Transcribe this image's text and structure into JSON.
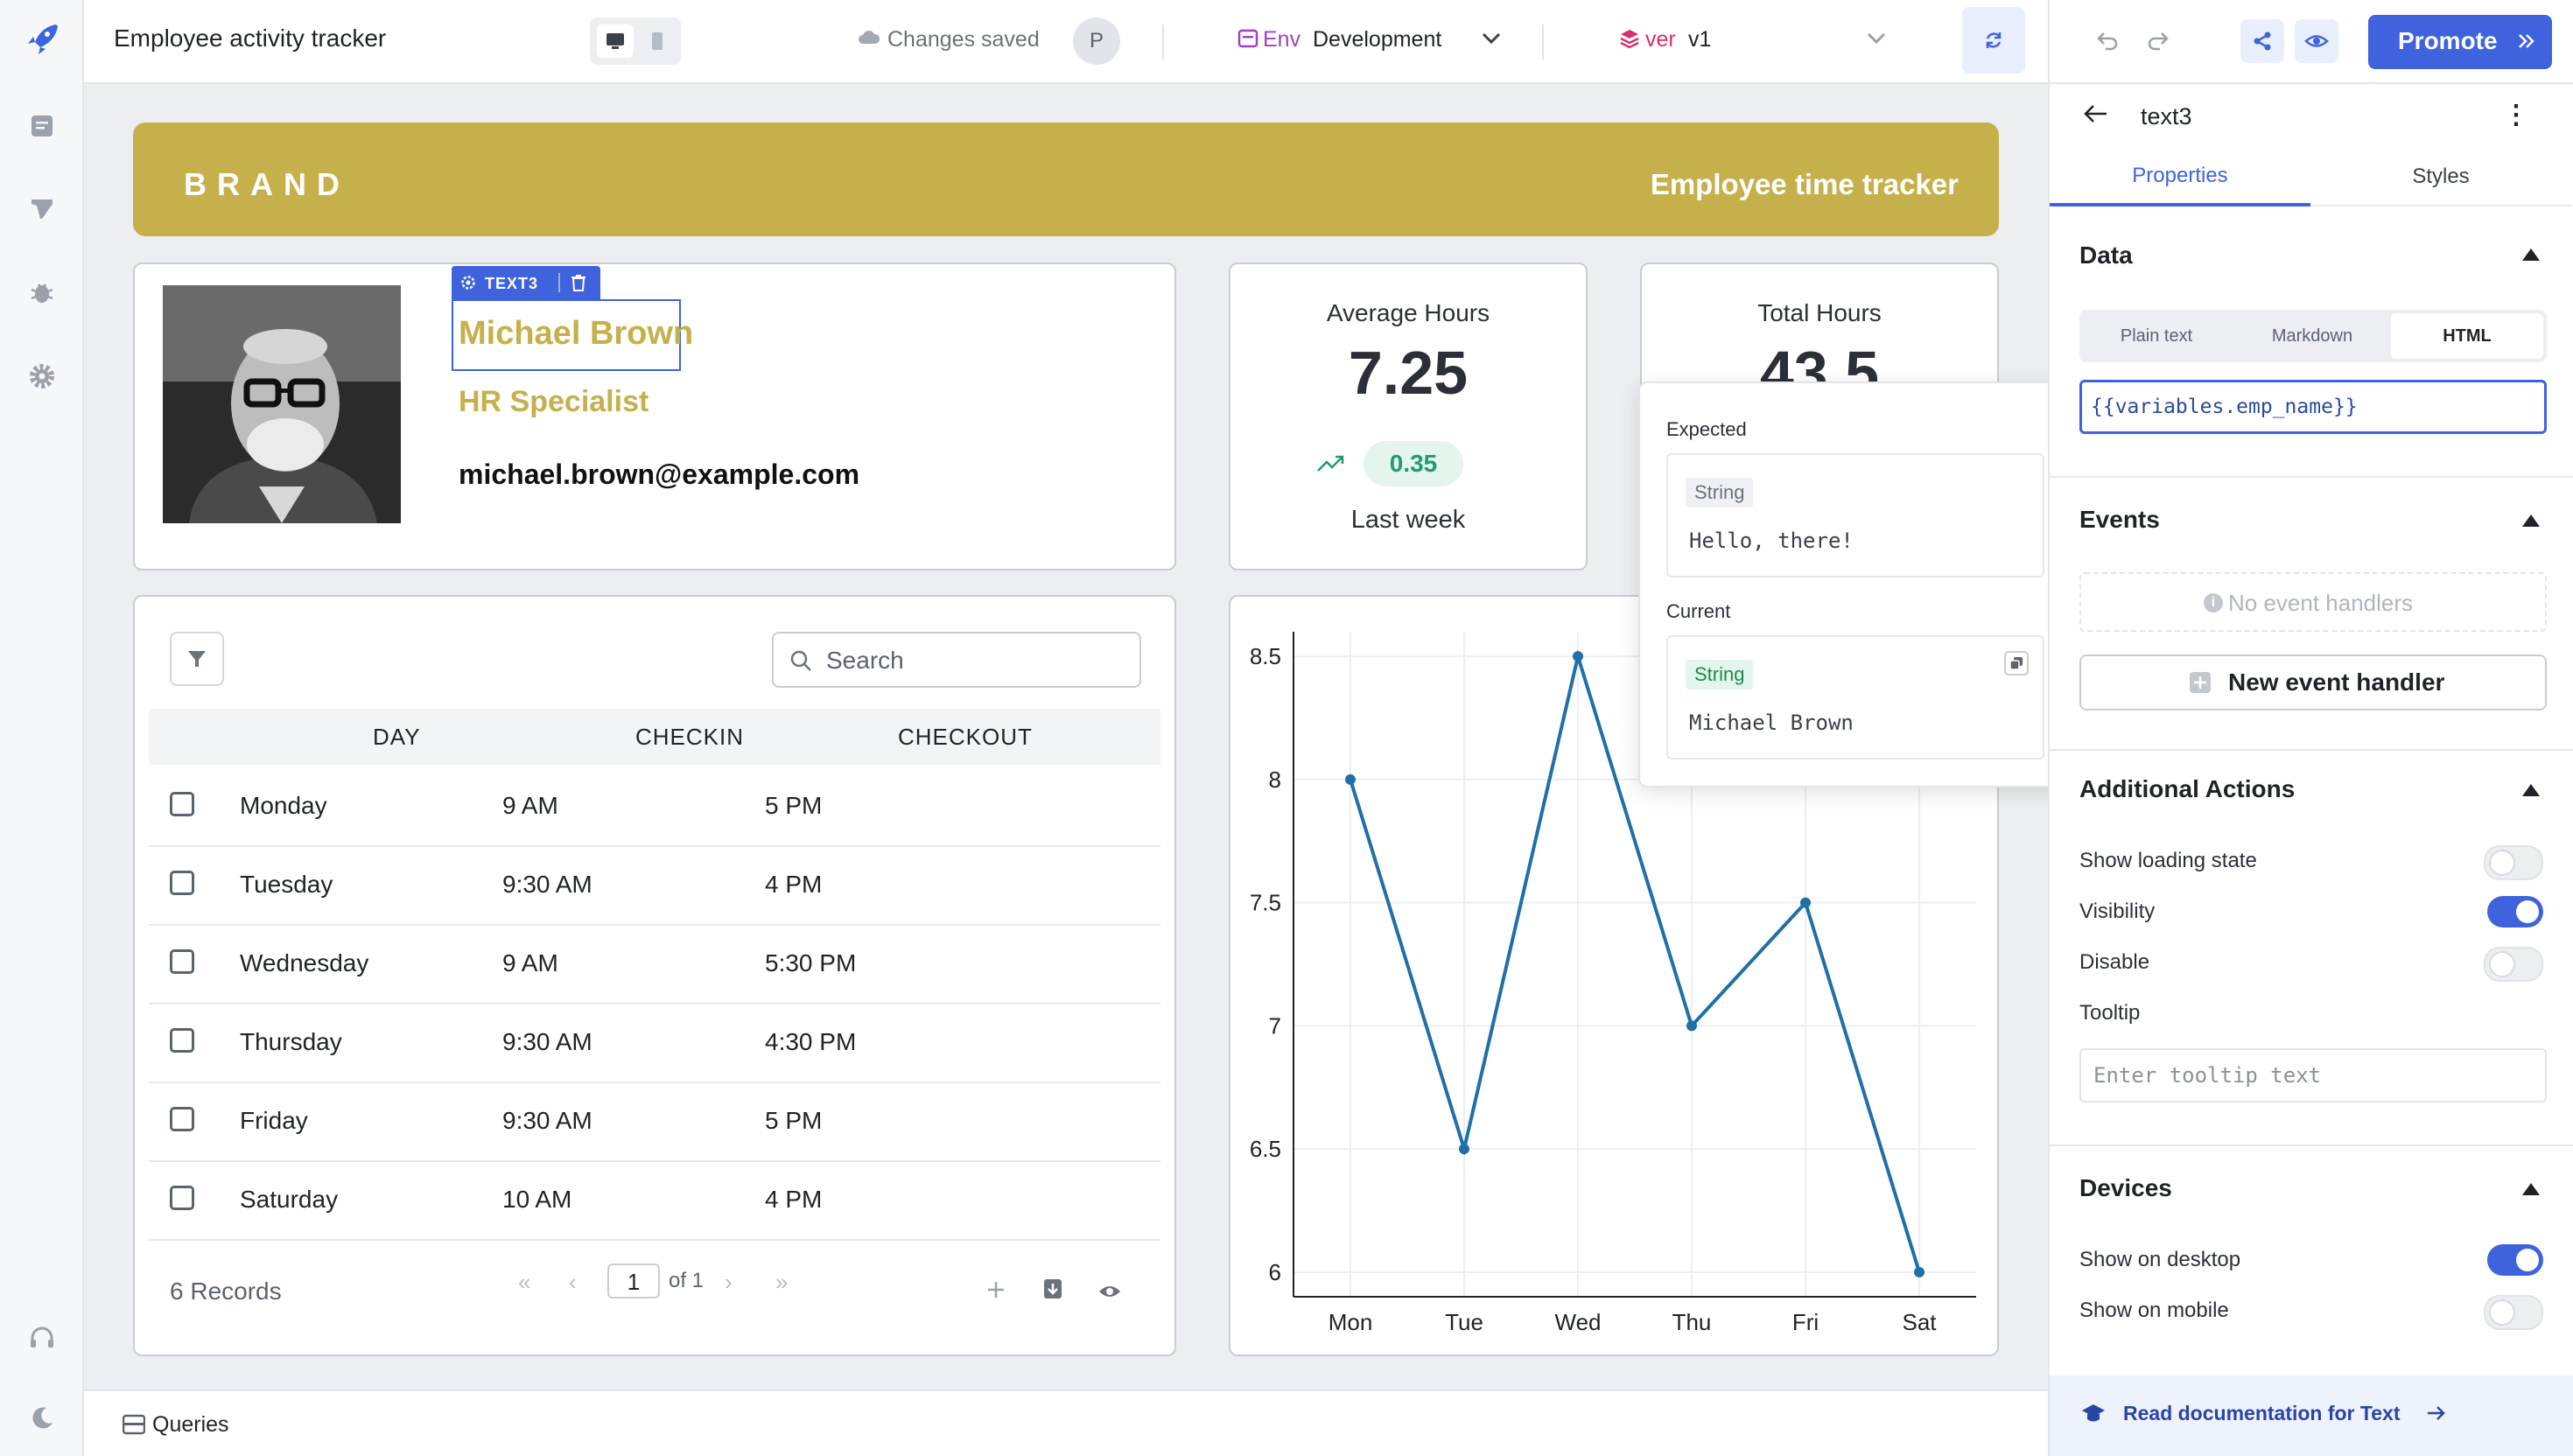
{
  "app": {
    "title": "Employee activity tracker",
    "save_status": "Changes saved",
    "avatar_initial": "P",
    "env_label": "Env",
    "env_value": "Development",
    "ver_label": "ver",
    "ver_value": "v1",
    "promote_label": "Promote"
  },
  "header": {
    "brand": "BRAND",
    "tracker_title": "Employee time tracker"
  },
  "profile": {
    "name": "Michael Brown",
    "role": "HR Specialist",
    "email": "michael.brown@example.com",
    "selected_tag": "TEXT3"
  },
  "stats": {
    "avg_title": "Average Hours",
    "avg_value": "7.25",
    "delta": "0.35",
    "period": "Last week",
    "total_title": "Total Hours",
    "total_value": "43.5"
  },
  "table": {
    "search_placeholder": "Search",
    "columns": [
      "DAY",
      "CHECKIN",
      "CHECKOUT"
    ],
    "rows": [
      [
        "Monday",
        "9 AM",
        "5 PM"
      ],
      [
        "Tuesday",
        "9:30 AM",
        "4 PM"
      ],
      [
        "Wednesday",
        "9 AM",
        "5:30 PM"
      ],
      [
        "Thursday",
        "9:30 AM",
        "4:30 PM"
      ],
      [
        "Friday",
        "9:30 AM",
        "5 PM"
      ],
      [
        "Saturday",
        "10 AM",
        "4 PM"
      ]
    ],
    "records": "6 Records",
    "page": "1",
    "page_of": "of 1"
  },
  "chart_data": {
    "type": "line",
    "categories": [
      "Mon",
      "Tue",
      "Wed",
      "Thu",
      "Fri",
      "Sat"
    ],
    "series": [
      {
        "values": [
          8,
          6.5,
          8.5,
          7,
          7.5,
          6
        ]
      }
    ],
    "ylim": [
      5.9,
      8.6
    ],
    "yticks": [
      6,
      6.5,
      7,
      7.5,
      8,
      8.5
    ],
    "grid": true,
    "color": "#1f6fa8"
  },
  "preview": {
    "expected_label": "Expected",
    "expected_type": "String",
    "expected_value": "Hello, there!",
    "current_label": "Current",
    "current_type": "String",
    "current_value": "Michael Brown"
  },
  "inspector": {
    "component": "text3",
    "tabs": [
      "Properties",
      "Styles"
    ],
    "data_title": "Data",
    "modes": [
      "Plain text",
      "Markdown",
      "HTML"
    ],
    "active_mode": "HTML",
    "expression": "{{variables.emp_name}}",
    "events_title": "Events",
    "no_events": "No event handlers",
    "new_event": "New event handler",
    "actions_title": "Additional Actions",
    "actions": [
      {
        "label": "Show loading state",
        "on": false
      },
      {
        "label": "Visibility",
        "on": true
      },
      {
        "label": "Disable",
        "on": false
      }
    ],
    "tooltip_label": "Tooltip",
    "tooltip_placeholder": "Enter tooltip text",
    "devices_title": "Devices",
    "devices": [
      {
        "label": "Show on desktop",
        "on": true
      },
      {
        "label": "Show on mobile",
        "on": false
      }
    ],
    "doc_link": "Read documentation for Text"
  },
  "footer": {
    "queries": "Queries"
  },
  "colors": {
    "brand": "#c6b04c",
    "accent": "#3e63dd",
    "line": "#1f6fa8",
    "positive": "#1f9d6b"
  }
}
